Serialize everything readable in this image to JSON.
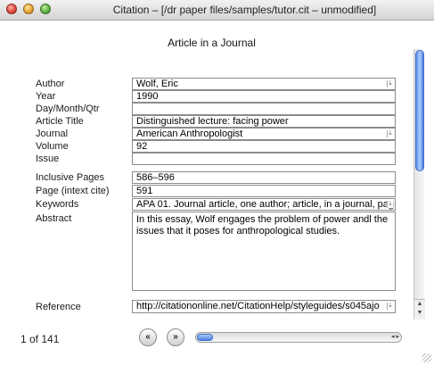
{
  "window": {
    "title": "Citation – [/dr paper files/samples/tutor.cit – unmodified]"
  },
  "form": {
    "heading": "Article in a Journal",
    "fields": [
      {
        "label": "Author",
        "value": "Wolf, Eric",
        "dropdown": true
      },
      {
        "label": "Year",
        "value": "1990",
        "dropdown": false
      },
      {
        "label": "Day/Month/Qtr",
        "value": "",
        "dropdown": false
      },
      {
        "label": "Article Title",
        "value": "Distinguished lecture: facing power",
        "dropdown": false
      },
      {
        "label": "Journal",
        "value": "American Anthropologist",
        "dropdown": true
      },
      {
        "label": "Volume",
        "value": "92",
        "dropdown": false
      },
      {
        "label": "Issue",
        "value": "",
        "dropdown": false
      },
      {
        "label": "Inclusive Pages",
        "value": "586–596",
        "dropdown": false
      },
      {
        "label": "Page (intext cite)",
        "value": "591",
        "dropdown": false
      },
      {
        "label": "Keywords",
        "value": "APA 01. Journal article, one author; article, in a journal, pag",
        "dropdown": true
      }
    ],
    "abstract": {
      "label": "Abstract",
      "value": "In this essay, Wolf engages the problem of power andl the issues that it poses for anthropological studies."
    },
    "reference": {
      "label": "Reference",
      "value": "http://citationonline.net/CitationHelp/styleguides/s045ajo"
    }
  },
  "navigation": {
    "record_status": "1 of 141",
    "prev_label": "«",
    "next_label": "»",
    "position_fraction": 0.0
  },
  "icons": {
    "close": "close-icon",
    "minimize": "minimize-icon",
    "zoom": "zoom-icon",
    "dropdown": "chevron-down-icon",
    "resize": "resize-grip-icon"
  }
}
